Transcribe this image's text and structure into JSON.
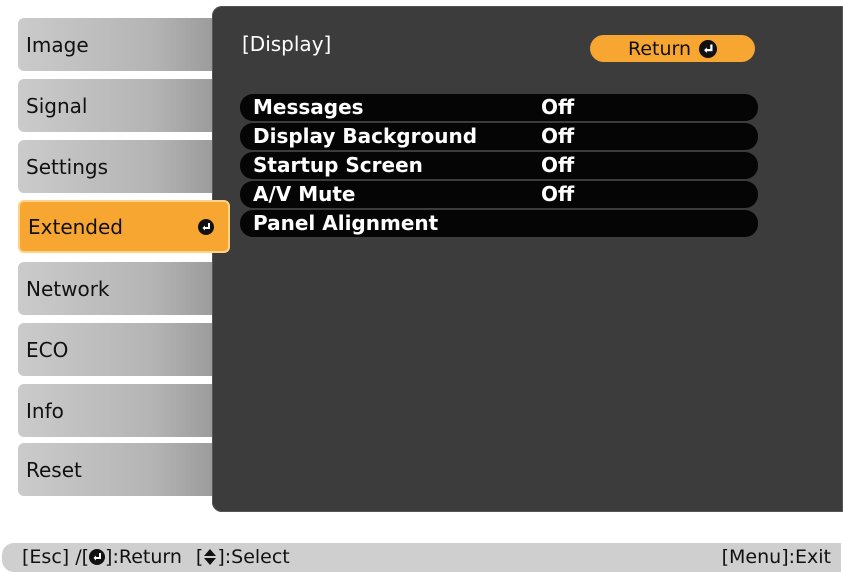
{
  "sidebar": {
    "items": [
      {
        "label": "Image",
        "active": false
      },
      {
        "label": "Signal",
        "active": false
      },
      {
        "label": "Settings",
        "active": false
      },
      {
        "label": "Extended",
        "active": true
      },
      {
        "label": "Network",
        "active": false
      },
      {
        "label": "ECO",
        "active": false
      },
      {
        "label": "Info",
        "active": false
      },
      {
        "label": "Reset",
        "active": false
      }
    ]
  },
  "panel": {
    "title": "[Display]",
    "return_label": "Return",
    "settings": [
      {
        "label": "Messages",
        "value": "Off"
      },
      {
        "label": "Display Background",
        "value": "Off"
      },
      {
        "label": "Startup Screen",
        "value": "Off"
      },
      {
        "label": "A/V Mute",
        "value": "Off"
      },
      {
        "label": "Panel Alignment",
        "value": ""
      }
    ]
  },
  "help_bar": {
    "esc_prefix": "[Esc] /[",
    "return_suffix": "]:Return",
    "select_prefix": "[",
    "select_suffix": "]:Select",
    "exit_hint": "[Menu]:Exit"
  },
  "colors": {
    "accent": "#f8a632",
    "panel_bg": "#3c3c3c",
    "row_bg": "#050505",
    "sidebar_bg": "#b4b4b4"
  },
  "icons": {
    "enter": "enter-icon",
    "up_down": "up-down-arrow-icon"
  }
}
